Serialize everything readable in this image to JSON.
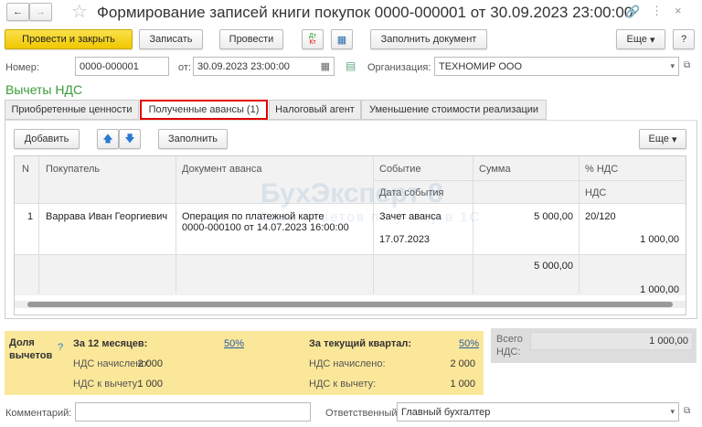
{
  "window": {
    "title": "Формирование записей книги покупок 0000-000001 от 30.09.2023 23:00:00"
  },
  "toolbar": {
    "post_close": "Провести и закрыть",
    "save": "Записать",
    "post": "Провести",
    "dtkt": "Дт Кт",
    "fill_doc": "Заполнить документ",
    "more": "Еще",
    "help": "?"
  },
  "header": {
    "number_label": "Номер:",
    "number": "0000-000001",
    "date_label": "от:",
    "date": "30.09.2023 23:00:00",
    "org_label": "Организация:",
    "org": "ТЕХНОМИР ООО"
  },
  "section_title": "Вычеты НДС",
  "tabs": [
    {
      "label": "Приобретенные ценности"
    },
    {
      "label": "Полученные авансы (1)",
      "active": true
    },
    {
      "label": "Налоговый агент"
    },
    {
      "label": "Уменьшение стоимости реализации"
    }
  ],
  "table_toolbar": {
    "add": "Добавить",
    "fill": "Заполнить",
    "more": "Еще"
  },
  "table": {
    "headers": {
      "n": "N",
      "buyer": "Покупатель",
      "doc": "Документ аванса",
      "event": "Событие",
      "event_date": "Дата события",
      "sum": "Сумма",
      "vat_rate": "% НДС",
      "vat": "НДС"
    },
    "rows": [
      {
        "n": "1",
        "buyer": "Варрава Иван Георгиевич",
        "doc_line1": "Операция по платежной карте",
        "doc_line2": "0000-000100 от 14.07.2023 16:00:00",
        "event": "Зачет аванса",
        "event_date": "17.07.2023",
        "sum": "5 000,00",
        "vat_rate": "20/120",
        "vat": "1 000,00"
      }
    ],
    "totals": {
      "sum": "5 000,00",
      "vat": "1 000,00"
    }
  },
  "watermark": {
    "brand": "БухЭксперт 8",
    "tagline": "База ответов по учёту в 1С"
  },
  "deductions": {
    "label": "Доля вычетов",
    "help": "?",
    "m12_title": "За 12 месяцев:",
    "m12_pct": "50%",
    "q_title": "За текущий квартал:",
    "q_pct": "50%",
    "accrued_label": "НДС начислено:",
    "deduct_label": "НДС к вычету:",
    "m12_accrued": "2 000",
    "m12_deduct": "1 000",
    "q_accrued": "2 000",
    "q_deduct": "1 000"
  },
  "total_vat": {
    "label": "Всего НДС:",
    "value": "1 000,00"
  },
  "footer": {
    "comment_label": "Комментарий:",
    "comment": "",
    "resp_label": "Ответственный:",
    "resp": "Главный бухгалтер"
  },
  "colors": {
    "primary": "#f5d31a",
    "section": "#3a9a3a",
    "highlight": "#e00000",
    "deduct_bg": "#fbe79a",
    "link": "#2a5ca8"
  }
}
